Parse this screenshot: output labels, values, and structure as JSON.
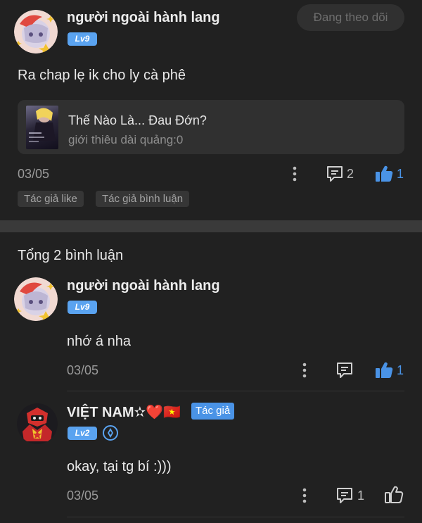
{
  "post": {
    "author": "người ngoài hành lang",
    "level": "Lv9",
    "follow_label": "Đang theo dõi",
    "text": "Ra chap lẹ ik cho ly cà phê",
    "link_card": {
      "title": "Thế Nào Là... Đau Đớn?",
      "subtitle": "giới thiêu dài quảng:0"
    },
    "date": "03/05",
    "comment_count": "2",
    "like_count": "1",
    "tags": [
      "Tác giả like",
      "Tác giả bình luận"
    ]
  },
  "comments_section": {
    "total_label": "Tổng 2 bình luận",
    "comments": [
      {
        "author": "người ngoài hành lang",
        "level": "Lv9",
        "text": "nhớ á nha",
        "date": "03/05",
        "comment_count": "",
        "like_count": "1"
      },
      {
        "author": "VIỆT NAM✫❤️🇻🇳",
        "level": "Lv2",
        "author_badge": "Tác giả",
        "text": "okay, tại tg bí :)))",
        "date": "03/05",
        "comment_count": "1",
        "like_count": ""
      }
    ]
  },
  "colors": {
    "background": "#212121",
    "accent_blue": "#4a93e6",
    "like_active": "#4a93e6",
    "muted_text": "#9a9a9a"
  },
  "icons": [
    "more-vertical-icon",
    "comment-icon",
    "thumbs-up-filled-icon",
    "thumbs-up-outline-icon",
    "verified-badge-icon"
  ]
}
